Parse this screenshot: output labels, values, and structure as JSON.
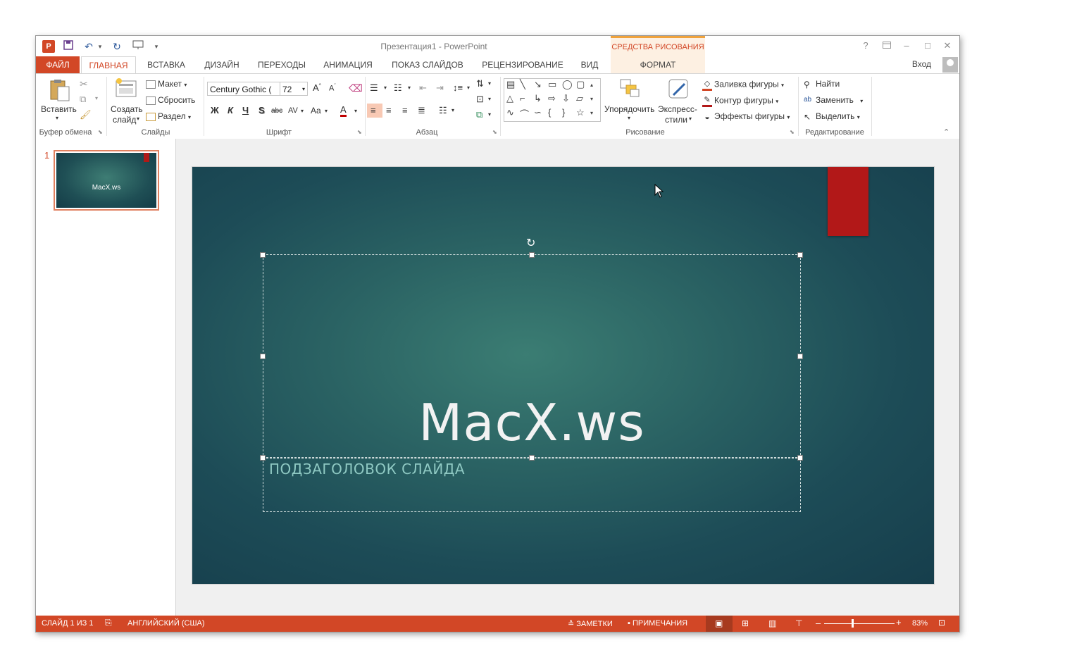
{
  "window": {
    "title": "Презентация1 - PowerPoint",
    "context_group": "СРЕДСТВА РИСОВАНИЯ",
    "help": "?",
    "login": "Вход"
  },
  "quick_access": [
    "app-logo",
    "save",
    "undo",
    "redo",
    "start-from-beginning",
    "customize"
  ],
  "tabs": [
    {
      "label": "ФАЙЛ"
    },
    {
      "label": "ГЛАВНАЯ"
    },
    {
      "label": "ВСТАВКА"
    },
    {
      "label": "ДИЗАЙН"
    },
    {
      "label": "ПЕРЕХОДЫ"
    },
    {
      "label": "АНИМАЦИЯ"
    },
    {
      "label": "ПОКАЗ СЛАЙДОВ"
    },
    {
      "label": "РЕЦЕНЗИРОВАНИЕ"
    },
    {
      "label": "ВИД"
    },
    {
      "label": "ФОРМАТ"
    }
  ],
  "ribbon": {
    "clipboard": {
      "paste": "Вставить",
      "label": "Буфер обмена"
    },
    "slides": {
      "new_slide_1": "Создать",
      "new_slide_2": "слайд",
      "layout": "Макет",
      "reset": "Сбросить",
      "section": "Раздел",
      "label": "Слайды"
    },
    "font": {
      "family": "Century Gothic (",
      "size": "72",
      "bold": "Ж",
      "italic": "К",
      "underline": "Ч",
      "shadow": "S",
      "strike": "abc",
      "spacing": "AV",
      "case": "Aa",
      "color": "A",
      "label": "Шрифт"
    },
    "paragraph": {
      "label": "Абзац"
    },
    "drawing": {
      "arrange": "Упорядочить",
      "quick_styles_1": "Экспресс-",
      "quick_styles_2": "стили",
      "fill": "Заливка фигуры",
      "outline": "Контур фигуры",
      "effects": "Эффекты фигуры",
      "label": "Рисование"
    },
    "editing": {
      "find": "Найти",
      "replace": "Заменить",
      "select": "Выделить",
      "label": "Редактирование"
    }
  },
  "thumbnails": [
    {
      "number": "1",
      "title": "MacX.ws"
    }
  ],
  "slide": {
    "title": "MacX.ws",
    "subtitle": "ПОДЗАГОЛОВОК СЛАЙДА"
  },
  "status": {
    "slide_info": "СЛАЙД 1 ИЗ 1",
    "language": "АНГЛИЙСКИЙ (США)",
    "notes": "ЗАМЕТКИ",
    "comments": "ПРИМЕЧАНИЯ",
    "zoom": "83%"
  },
  "colors": {
    "accent": "#d24726",
    "slide_red": "#b21818",
    "slide_bg": "#2a6263"
  }
}
